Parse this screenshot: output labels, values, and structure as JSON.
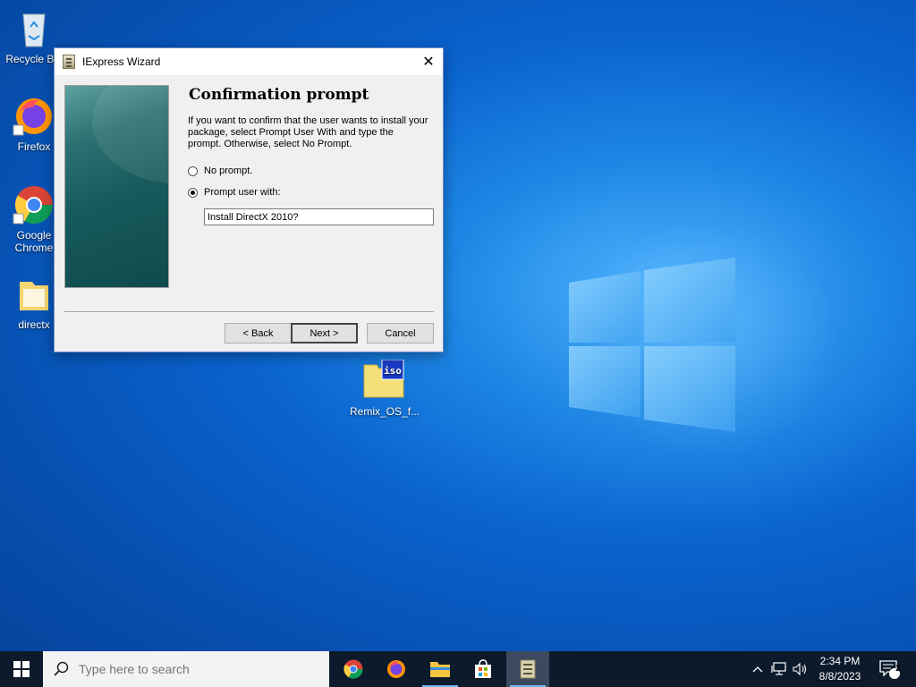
{
  "desktop": {
    "icons": [
      {
        "label": "Recycle Bin",
        "icon": "recycle-bin-icon"
      },
      {
        "label": "Firefox",
        "icon": "firefox-icon"
      },
      {
        "label": "Google Chrome",
        "icon": "chrome-icon"
      },
      {
        "label": "directx",
        "icon": "folder-icon"
      },
      {
        "label": "Remix_OS_f...",
        "icon": "iso-file-icon"
      }
    ]
  },
  "dialog": {
    "title": "IExpress Wizard",
    "heading": "Confirmation prompt",
    "description": "If you want to confirm that the user wants to install your package, select Prompt User With and type the prompt. Otherwise, select No Prompt.",
    "options": [
      {
        "label": "No prompt.",
        "selected": false
      },
      {
        "label": "Prompt user with:",
        "selected": true
      }
    ],
    "prompt_value": "Install DirectX 2010?",
    "buttons": {
      "back": "< Back",
      "next": "Next >",
      "cancel": "Cancel"
    }
  },
  "taskbar": {
    "search_placeholder": "Type here to search",
    "pinned": [
      "chrome-icon",
      "firefox-icon",
      "file-explorer-icon",
      "store-icon",
      "iexpress-icon"
    ],
    "time": "2:34 PM",
    "date": "8/8/2023",
    "notification_count": "2"
  },
  "colors": {
    "accent": "#0a63cf",
    "taskbar": "#0c1a2c",
    "dialog_bg": "#f0f0f0"
  }
}
